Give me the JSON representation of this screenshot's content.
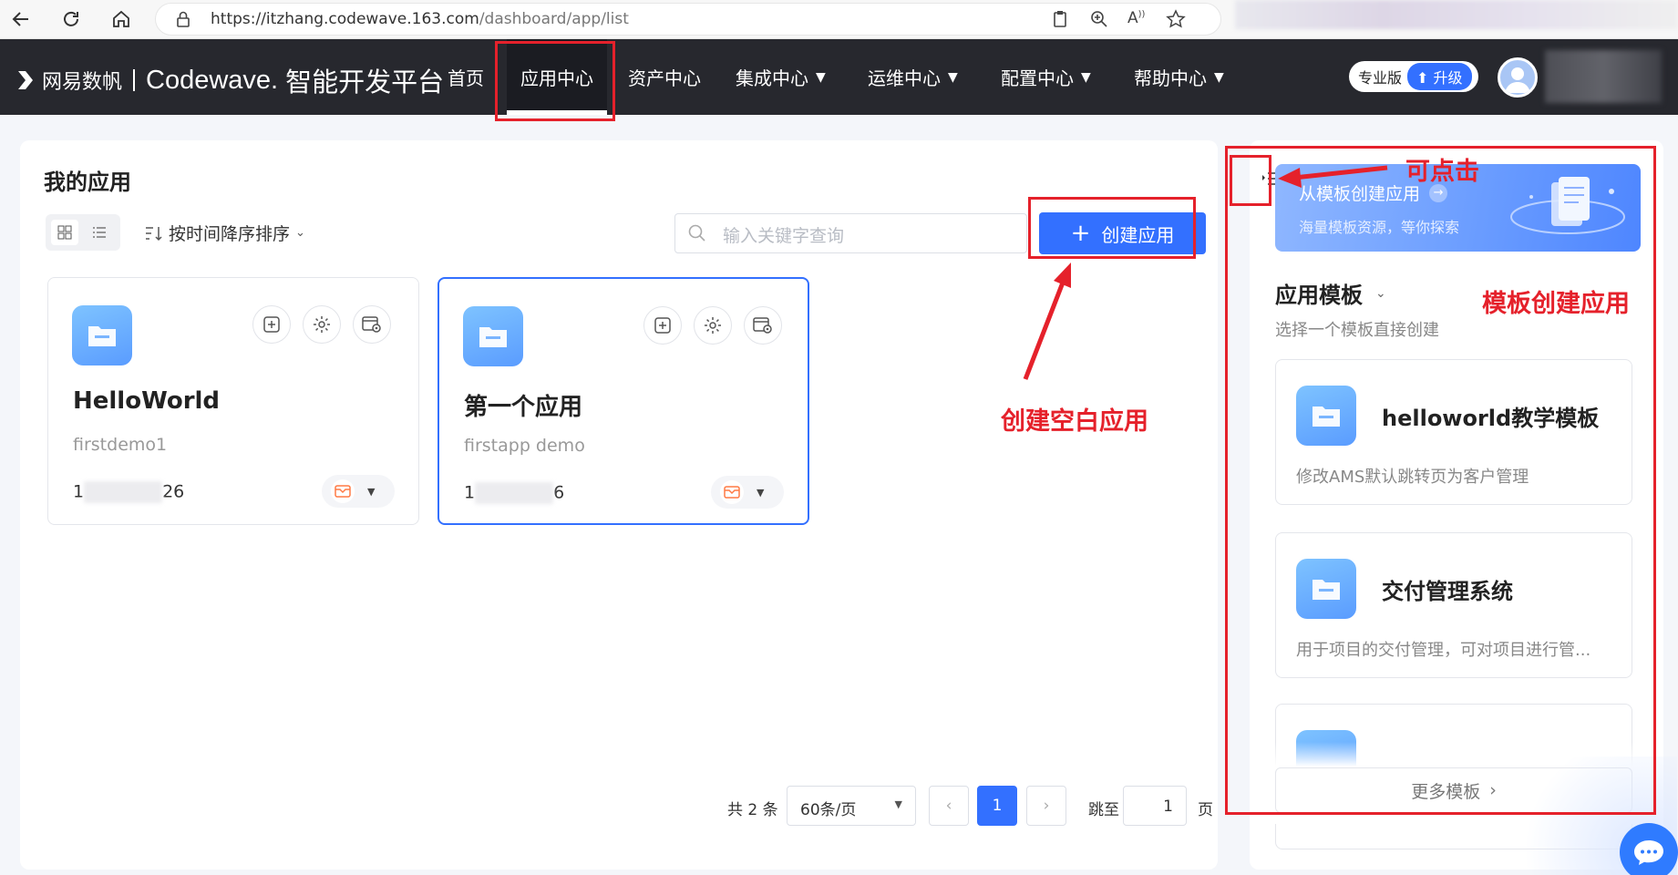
{
  "browser": {
    "url_main": "https://itzhang.codewave.163.com",
    "url_path": "/dashboard/app/list"
  },
  "nav": {
    "brand_cn": "网易数帆",
    "brand_name": "Codewave.",
    "brand_platform": "智能开发平台",
    "items": [
      {
        "label": "首页"
      },
      {
        "label": "应用中心"
      },
      {
        "label": "资产中心"
      },
      {
        "label": "集成中心"
      },
      {
        "label": "运维中心"
      },
      {
        "label": "配置中心"
      },
      {
        "label": "帮助中心"
      }
    ],
    "pro_label": "专业版",
    "upgrade_label": "升级"
  },
  "main": {
    "title": "我的应用",
    "sort_label": "按时间降序排序",
    "search_placeholder": "输入关键字查询",
    "create_label": "创建应用",
    "apps": [
      {
        "name": "HelloWorld",
        "desc": "firstdemo1",
        "date_start": "1",
        "date_end": "26"
      },
      {
        "name": "第一个应用",
        "desc": "firstapp demo",
        "date_start": "1",
        "date_end": "6"
      }
    ],
    "pagination": {
      "total": "共 2 条",
      "page_size": "60条/页",
      "current": "1",
      "jump_label": "跳至",
      "jump_value": "1",
      "page_unit": "页"
    }
  },
  "side": {
    "banner_title": "从模板创建应用",
    "banner_sub": "海量模板资源，等你探索",
    "templates_title": "应用模板",
    "templates_sub": "选择一个模板直接创建",
    "templates": [
      {
        "name": "helloworld教学模板",
        "desc": "修改AMS默认跳转页为客户管理"
      },
      {
        "name": "交付管理系统",
        "desc": "用于项目的交付管理，可对项目进行管..."
      }
    ],
    "more_label": "更多模板"
  },
  "annotations": {
    "clickable": "可点击",
    "template_create": "模板创建应用",
    "blank_create": "创建空白应用"
  },
  "colors": {
    "accent": "#3370ff",
    "nav_bg": "#27282e",
    "annotation": "#e5212b"
  }
}
